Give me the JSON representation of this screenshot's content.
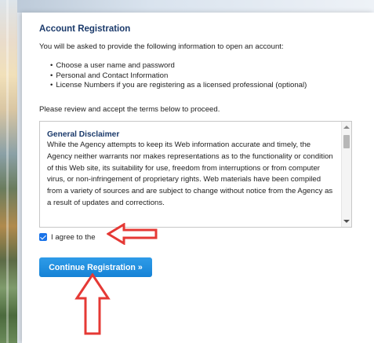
{
  "registration": {
    "heading": "Account Registration",
    "intro": "You will be asked to provide the following information to open an account:",
    "items": [
      "Choose a user name and password",
      "Personal and Contact Information",
      "License Numbers if you are registering as a licensed professional (optional)"
    ],
    "review_note": "Please review and accept the terms below to proceed."
  },
  "terms": {
    "title": "General Disclaimer",
    "body": "While the Agency attempts to keep its Web information accurate and timely, the Agency neither warrants nor makes representations as to the functionality or condition of this Web site, its suitability for use, freedom from interruptions or from computer virus, or non-infringement of proprietary rights. Web materials have been compiled from a variety of sources and are subject to change without notice from the Agency as a result of updates and corrections."
  },
  "agree": {
    "label": "I agree to the",
    "checked": true
  },
  "continue_button": {
    "label": "Continue Registration »"
  },
  "annotations": {
    "arrow_color": "#e53935",
    "arrow_outline": "#d11f1f"
  },
  "icons": {
    "checkbox": "checkbox-checked-icon",
    "scroll_up": "scroll-up-arrow-icon",
    "scroll_down": "scroll-down-arrow-icon"
  }
}
